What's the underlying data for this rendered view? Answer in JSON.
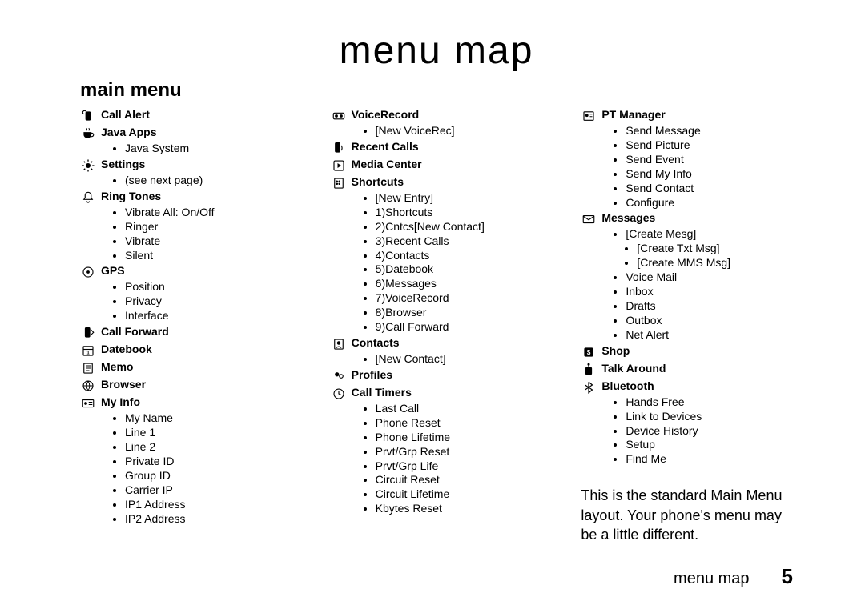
{
  "title": "menu map",
  "subtitle": "main menu",
  "footer_title": "menu map",
  "footer_page": "5",
  "note": "This is the standard Main Menu layout. Your phone's menu may be a little different.",
  "columns": [
    [
      {
        "icon": "signal-phone-icon",
        "label": "Call Alert",
        "items": []
      },
      {
        "icon": "java-cup-icon",
        "label": "Java Apps",
        "items": [
          "Java System"
        ]
      },
      {
        "icon": "settings-icon",
        "label": "Settings",
        "items": [
          "(see next page)"
        ]
      },
      {
        "icon": "bell-icon",
        "label": "Ring Tones",
        "items": [
          "Vibrate All: On/Off",
          "Ringer",
          "Vibrate",
          "Silent"
        ]
      },
      {
        "icon": "target-icon",
        "label": "GPS",
        "items": [
          "Position",
          "Privacy",
          "Interface"
        ]
      },
      {
        "icon": "phone-arrow-icon",
        "label": "Call Forward",
        "items": []
      },
      {
        "icon": "calendar-icon",
        "label": "Datebook",
        "items": []
      },
      {
        "icon": "note-icon",
        "label": "Memo",
        "items": []
      },
      {
        "icon": "globe-icon",
        "label": "Browser",
        "items": []
      },
      {
        "icon": "id-card-icon",
        "label": "My Info",
        "items": [
          "My Name",
          "Line 1",
          "Line 2",
          "Private ID",
          "Group ID",
          "Carrier IP",
          "IP1 Address",
          "IP2 Address"
        ]
      }
    ],
    [
      {
        "icon": "tape-icon",
        "label": "VoiceRecord",
        "items": [
          "[New VoiceRec]"
        ]
      },
      {
        "icon": "recent-calls-icon",
        "label": "Recent Calls",
        "items": []
      },
      {
        "icon": "media-icon",
        "label": "Media Center",
        "items": []
      },
      {
        "icon": "shortcut-icon",
        "label": "Shortcuts",
        "items": [
          "[New Entry]",
          "1)Shortcuts",
          "2)Cntcs[New Contact]",
          "3)Recent Calls",
          "4)Contacts",
          "5)Datebook",
          "6)Messages",
          "7)VoiceRecord",
          "8)Browser",
          "9)Call Forward"
        ]
      },
      {
        "icon": "contacts-icon",
        "label": "Contacts",
        "items": [
          "[New Contact]"
        ]
      },
      {
        "icon": "profiles-icon",
        "label": "Profiles",
        "items": []
      },
      {
        "icon": "clock-icon",
        "label": "Call Timers",
        "items": [
          "Last Call",
          "Phone Reset",
          "Phone Lifetime",
          "Prvt/Grp Reset",
          "Prvt/Grp Life",
          "Circuit Reset",
          "Circuit Lifetime",
          "Kbytes Reset"
        ]
      }
    ],
    [
      {
        "icon": "manager-icon",
        "label": "PT Manager",
        "items": [
          "Send Message",
          "Send Picture",
          "Send Event",
          "Send My Info",
          "Send Contact",
          "Configure"
        ]
      },
      {
        "icon": "envelope-icon",
        "label": "Messages",
        "items": [
          "[Create Mesg]"
        ],
        "subitems": [
          "[Create Txt Msg]",
          "[Create MMS Msg]"
        ],
        "items2": [
          "Voice Mail",
          "Inbox",
          "Drafts",
          "Outbox",
          "Net Alert"
        ]
      },
      {
        "icon": "shop-icon",
        "label": "Shop",
        "items": []
      },
      {
        "icon": "radio-icon",
        "label": "Talk Around",
        "items": []
      },
      {
        "icon": "bluetooth-icon",
        "label": "Bluetooth",
        "items": [
          "Hands Free",
          "Link to Devices",
          "Device History",
          "Setup",
          "Find Me"
        ]
      }
    ]
  ]
}
